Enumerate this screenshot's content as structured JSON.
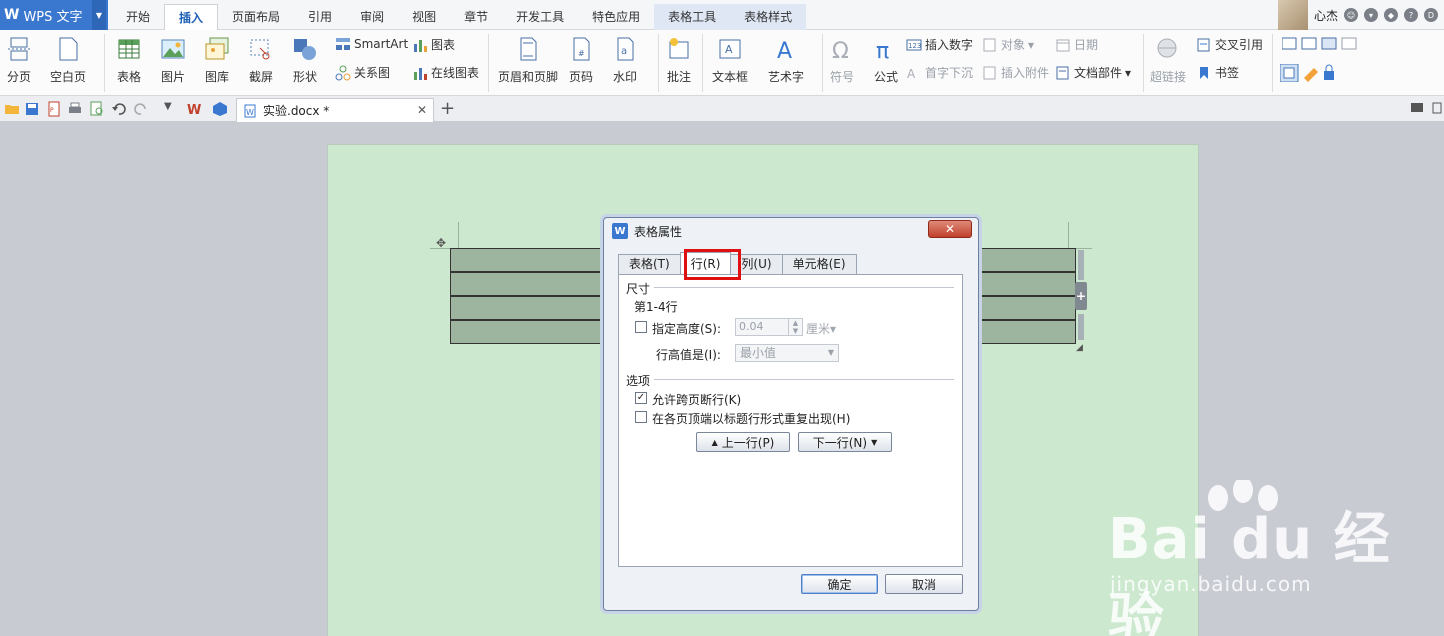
{
  "app": {
    "name": "WPS 文字"
  },
  "menu": {
    "tabs": [
      "开始",
      "插入",
      "页面布局",
      "引用",
      "审阅",
      "视图",
      "章节",
      "开发工具",
      "特色应用",
      "表格工具",
      "表格样式"
    ],
    "active_tab": "插入"
  },
  "user": {
    "name": "心杰"
  },
  "ribbon": {
    "page_break": "分页",
    "blank_page": "空白页",
    "table": "表格",
    "picture": "图片",
    "gallery": "图库",
    "screenshot": "截屏",
    "shape": "形状",
    "smartart": "SmartArt",
    "chart": "图表",
    "relation": "关系图",
    "online_chart": "在线图表",
    "header_footer": "页眉和页脚",
    "page_number": "页码",
    "watermark": "水印",
    "comment": "批注",
    "textbox": "文本框",
    "wordart": "艺术字",
    "symbol": "符号",
    "formula": "公式",
    "insert_number": "插入数字",
    "object": "对象",
    "date": "日期",
    "drop_cap": "首字下沉",
    "attachment": "插入附件",
    "doc_parts": "文档部件",
    "hyperlink": "超链接",
    "cross_ref": "交叉引用",
    "bookmark": "书签"
  },
  "document": {
    "tab_title": "实验.docx *"
  },
  "dialog": {
    "title": "表格属性",
    "tabs": [
      "表格(T)",
      "行(R)",
      "列(U)",
      "单元格(E)"
    ],
    "active_tab": "行(R)",
    "size_section": "尺寸",
    "rows_label": "第1-4行",
    "specify_height": "指定高度(S):",
    "height_value": "0.04",
    "height_unit": "厘米",
    "row_height_is": "行高值是(I):",
    "row_height_mode": "最小值",
    "options_section": "选项",
    "allow_break": "允许跨页断行(K)",
    "allow_break_checked": true,
    "repeat_header": "在各页顶端以标题行形式重复出现(H)",
    "repeat_header_checked": false,
    "prev_row": "上一行(P)",
    "next_row": "下一行(N)",
    "ok": "确定",
    "cancel": "取消"
  },
  "watermark": {
    "main": "Bai du 经验",
    "sub": "jingyan.baidu.com"
  }
}
